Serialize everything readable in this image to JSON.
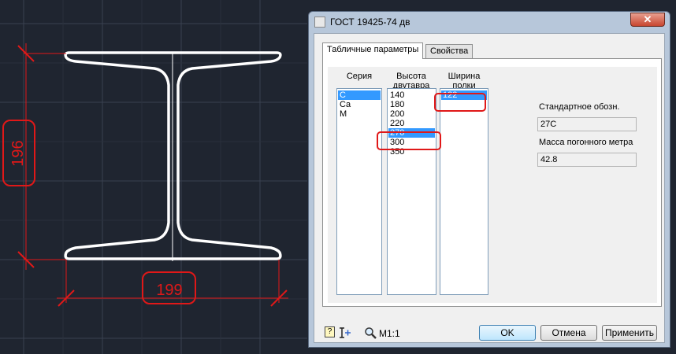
{
  "drawing": {
    "dim_height": "196",
    "dim_width": "199",
    "highlight_color": "#e01818",
    "line_color": "#ffffff",
    "background_color": "#1f2530"
  },
  "dialog": {
    "title": "ГОСТ 19425-74 дв",
    "close": "✕",
    "tabs": [
      "Табличные параметры",
      "Свойства"
    ],
    "columns": {
      "series": {
        "header": "Серия",
        "items": [
          "C",
          "Ca",
          "M"
        ],
        "selected": "C"
      },
      "height": {
        "header1": "Высота",
        "header2": "двутавра",
        "items": [
          "140",
          "180",
          "200",
          "220",
          "270",
          "300",
          "350"
        ],
        "selected": "270"
      },
      "width": {
        "header1": "Ширина",
        "header2": "полки",
        "items": [
          "122"
        ],
        "selected": "122"
      }
    },
    "designation_label": "Стандартное обозн.",
    "designation_value": "27C",
    "mass_label": "Масса погонного метра",
    "mass_value": "42.8",
    "scale": "M1:1",
    "buttons": {
      "ok": "OK",
      "cancel": "Отмена",
      "apply": "Применить"
    },
    "icons": [
      "help-icon",
      "pick-point-icon",
      "zoom-icon"
    ]
  }
}
